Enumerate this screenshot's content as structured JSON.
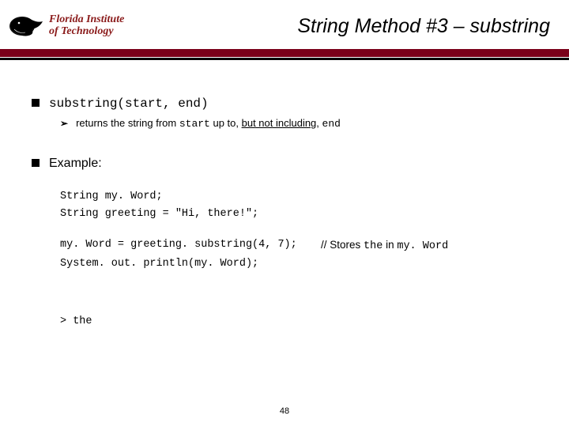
{
  "header": {
    "institution_line1": "Florida Institute",
    "institution_line2": "of Technology",
    "title": "String Method #3 – substring"
  },
  "bullet1": {
    "code": "substring(start, end)",
    "sub_prefix": "returns the string from ",
    "sub_code1": "start",
    "sub_mid": " up to, ",
    "sub_underlined": "but not including",
    "sub_mid2": ", ",
    "sub_code2": "end"
  },
  "bullet2": {
    "label": "Example:"
  },
  "code": {
    "l1": "String my. Word;",
    "l2": "String greeting = \"Hi, there!\";",
    "l3_left": "my. Word = greeting. substring(4, 7);",
    "l3_comment_pre": "// Stores ",
    "l3_comment_code1": "the",
    "l3_comment_mid": " in ",
    "l3_comment_code2": "my. Word",
    "l4": "System. out. println(my. Word);",
    "out": "> the"
  },
  "page_number": "48"
}
